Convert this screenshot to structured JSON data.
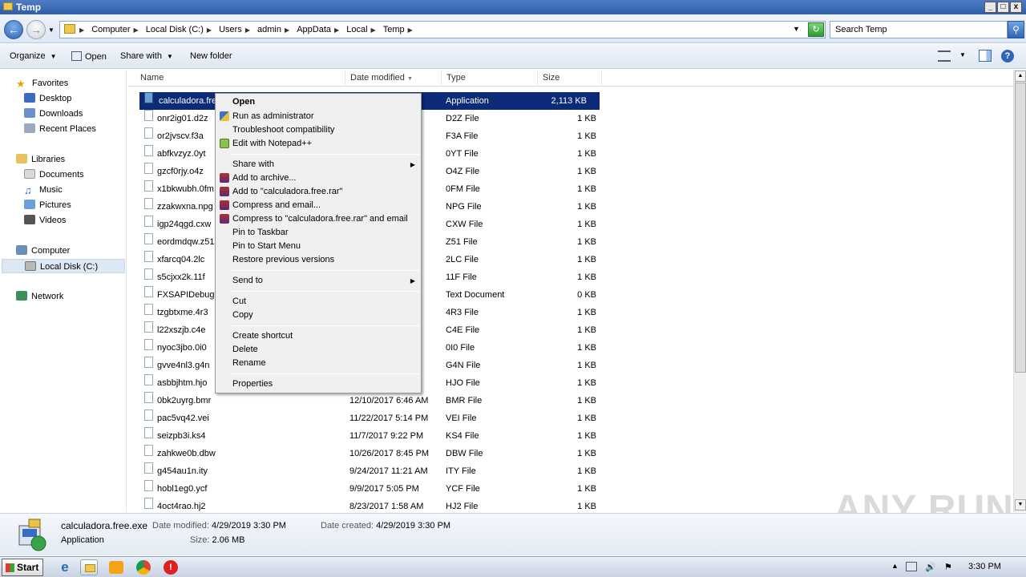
{
  "window": {
    "title": "Temp",
    "min_label": "_",
    "max_label": "□",
    "close_label": "x"
  },
  "address": {
    "crumbs": [
      "Computer",
      "Local Disk (C:)",
      "Users",
      "admin",
      "AppData",
      "Local",
      "Temp"
    ],
    "search_placeholder": "Search Temp"
  },
  "toolbar": {
    "organize": "Organize",
    "open": "Open",
    "share_with": "Share with",
    "new_folder": "New folder"
  },
  "nav": {
    "favorites": "Favorites",
    "desktop": "Desktop",
    "downloads": "Downloads",
    "recent": "Recent Places",
    "libraries": "Libraries",
    "documents": "Documents",
    "music": "Music",
    "pictures": "Pictures",
    "videos": "Videos",
    "computer": "Computer",
    "local_disk": "Local Disk (C:)",
    "network": "Network"
  },
  "columns": {
    "name": "Name",
    "date": "Date modified",
    "type": "Type",
    "size": "Size"
  },
  "files": [
    {
      "name": "calculadora.free.exe",
      "date": "",
      "type": "Application",
      "size": "2,113 KB"
    },
    {
      "name": "onr2ig01.d2z",
      "date": "",
      "type": "D2Z File",
      "size": "1 KB"
    },
    {
      "name": "or2jvscv.f3a",
      "date": "",
      "type": "F3A File",
      "size": "1 KB"
    },
    {
      "name": "abfkvzyz.0yt",
      "date": "",
      "type": "0YT File",
      "size": "1 KB"
    },
    {
      "name": "gzcf0rjy.o4z",
      "date": "",
      "type": "O4Z File",
      "size": "1 KB"
    },
    {
      "name": "x1bkwubh.0fm",
      "date": "",
      "type": "0FM File",
      "size": "1 KB"
    },
    {
      "name": "zzakwxna.npg",
      "date": "",
      "type": "NPG File",
      "size": "1 KB"
    },
    {
      "name": "igp24qgd.cxw",
      "date": "",
      "type": "CXW File",
      "size": "1 KB"
    },
    {
      "name": "eordmdqw.z51",
      "date": "",
      "type": "Z51 File",
      "size": "1 KB"
    },
    {
      "name": "xfarcq04.2lc",
      "date": "",
      "type": "2LC File",
      "size": "1 KB"
    },
    {
      "name": "s5cjxx2k.11f",
      "date": "",
      "type": "11F File",
      "size": "1 KB"
    },
    {
      "name": "FXSAPIDebugL",
      "date": "",
      "type": "Text Document",
      "size": "0 KB"
    },
    {
      "name": "tzgbtxme.4r3",
      "date": "",
      "type": "4R3 File",
      "size": "1 KB"
    },
    {
      "name": "l22xszjb.c4e",
      "date": "",
      "type": "C4E File",
      "size": "1 KB"
    },
    {
      "name": "nyoc3jbo.0i0",
      "date": "",
      "type": "0I0 File",
      "size": "1 KB"
    },
    {
      "name": "gvve4nl3.g4n",
      "date": "",
      "type": "G4N File",
      "size": "1 KB"
    },
    {
      "name": "asbbjhtm.hjo",
      "date": "",
      "type": "HJO File",
      "size": "1 KB"
    },
    {
      "name": "0bk2uyrg.bmr",
      "date": "12/10/2017 6:46 AM",
      "type": "BMR File",
      "size": "1 KB"
    },
    {
      "name": "pac5vq42.vei",
      "date": "11/22/2017 5:14 PM",
      "type": "VEI File",
      "size": "1 KB"
    },
    {
      "name": "seizpb3i.ks4",
      "date": "11/7/2017 9:22 PM",
      "type": "KS4 File",
      "size": "1 KB"
    },
    {
      "name": "zahkwe0b.dbw",
      "date": "10/26/2017 8:45 PM",
      "type": "DBW File",
      "size": "1 KB"
    },
    {
      "name": "g454au1n.ity",
      "date": "9/24/2017 11:21 AM",
      "type": "ITY File",
      "size": "1 KB"
    },
    {
      "name": "hobl1eg0.ycf",
      "date": "9/9/2017 5:05 PM",
      "type": "YCF File",
      "size": "1 KB"
    },
    {
      "name": "4oct4rao.hj2",
      "date": "8/23/2017 1:58 AM",
      "type": "HJ2 File",
      "size": "1 KB"
    }
  ],
  "context_menu": {
    "open": "Open",
    "run_admin": "Run as administrator",
    "troubleshoot": "Troubleshoot compatibility",
    "edit_notepad": "Edit with Notepad++",
    "share_with": "Share with",
    "add_archive": "Add to archive...",
    "add_rar": "Add to \"calculadora.free.rar\"",
    "compress_email": "Compress and email...",
    "compress_rar_email": "Compress to \"calculadora.free.rar\" and email",
    "pin_taskbar": "Pin to Taskbar",
    "pin_start": "Pin to Start Menu",
    "restore": "Restore previous versions",
    "send_to": "Send to",
    "cut": "Cut",
    "copy": "Copy",
    "create_shortcut": "Create shortcut",
    "delete": "Delete",
    "rename": "Rename",
    "properties": "Properties"
  },
  "details": {
    "filename": "calculadora.free.exe",
    "filetype": "Application",
    "date_modified_label": "Date modified:",
    "date_modified": "4/29/2019 3:30 PM",
    "date_created_label": "Date created:",
    "date_created": "4/29/2019 3:30 PM",
    "size_label": "Size:",
    "size": "2.06 MB"
  },
  "watermark": "ANY RUN",
  "taskbar": {
    "start": "Start",
    "clock": "3:30 PM"
  },
  "colors": {
    "selection": "#0b2a78",
    "titlebar": "#2f5ea8"
  }
}
